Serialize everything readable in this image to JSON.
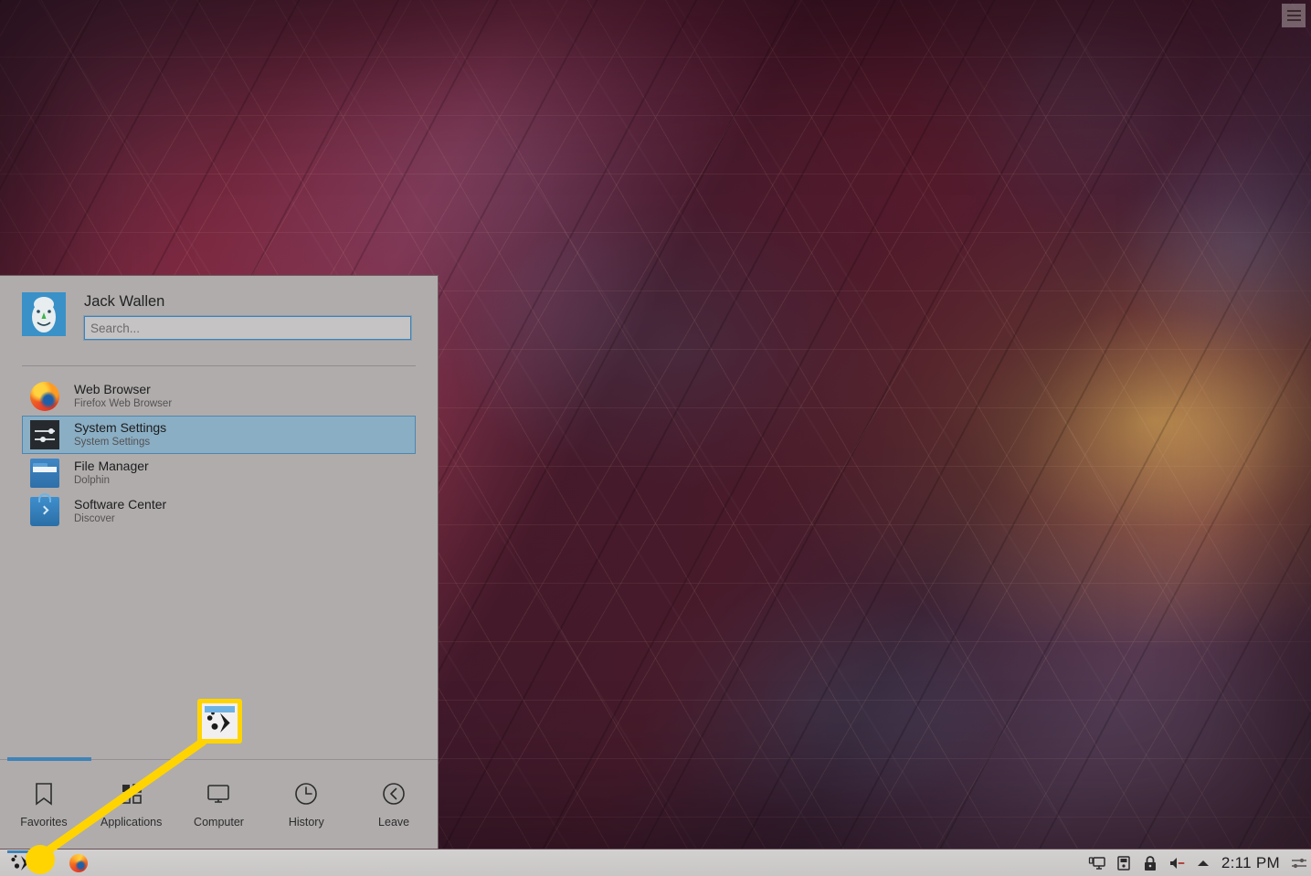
{
  "desktop": {
    "wallpaper_name": "milky-way-hexagons",
    "toolbox": {
      "name": "desktop-toolbox",
      "glyph": "hamburger"
    },
    "colors": {
      "accent": "#3d83b8",
      "selection_fill": "#8aaec4",
      "menu_background": "#b0acac",
      "panel_background": "#d3d0d0",
      "annotation": "#ffd400"
    }
  },
  "kickoff": {
    "user": {
      "name": "Jack Wallen",
      "avatar": "user-avatar"
    },
    "search": {
      "value": "",
      "placeholder": "Search..."
    },
    "favorites": [
      {
        "name": "Web Browser",
        "subtitle": "Firefox Web Browser",
        "icon": "firefox-icon",
        "selected": false
      },
      {
        "name": "System Settings",
        "subtitle": "System Settings",
        "icon": "settings-icon",
        "selected": true
      },
      {
        "name": "File Manager",
        "subtitle": "Dolphin",
        "icon": "folder-icon",
        "selected": false
      },
      {
        "name": "Software Center",
        "subtitle": "Discover",
        "icon": "discover-icon",
        "selected": false
      }
    ],
    "tabs": [
      {
        "label": "Favorites",
        "icon": "bookmark-icon",
        "active": true
      },
      {
        "label": "Applications",
        "icon": "grid-icon",
        "active": false
      },
      {
        "label": "Computer",
        "icon": "monitor-icon",
        "active": false
      },
      {
        "label": "History",
        "icon": "clock-icon",
        "active": false
      },
      {
        "label": "Leave",
        "icon": "back-icon",
        "active": false
      }
    ]
  },
  "panel": {
    "launcher": {
      "name": "application-launcher",
      "icon": "plasma-icon",
      "active": true
    },
    "tasks": [
      {
        "name": "Firefox",
        "icon": "firefox-icon"
      }
    ],
    "tray": [
      {
        "name": "network-icon",
        "title": "Network"
      },
      {
        "name": "removable-media-icon",
        "title": "Removable Devices"
      },
      {
        "name": "lock-icon",
        "title": "Secure Storage"
      },
      {
        "name": "volume-muted-icon",
        "title": "Audio Volume"
      },
      {
        "name": "show-hidden-icon",
        "title": "Show hidden icons"
      }
    ],
    "clock": "2:11 PM",
    "toolbox": {
      "name": "panel-toolbox",
      "icon": "sliders-icon"
    }
  },
  "annotation": {
    "callout_icon": "plasma-launcher-zoomed",
    "line_color": "#ffd400"
  }
}
